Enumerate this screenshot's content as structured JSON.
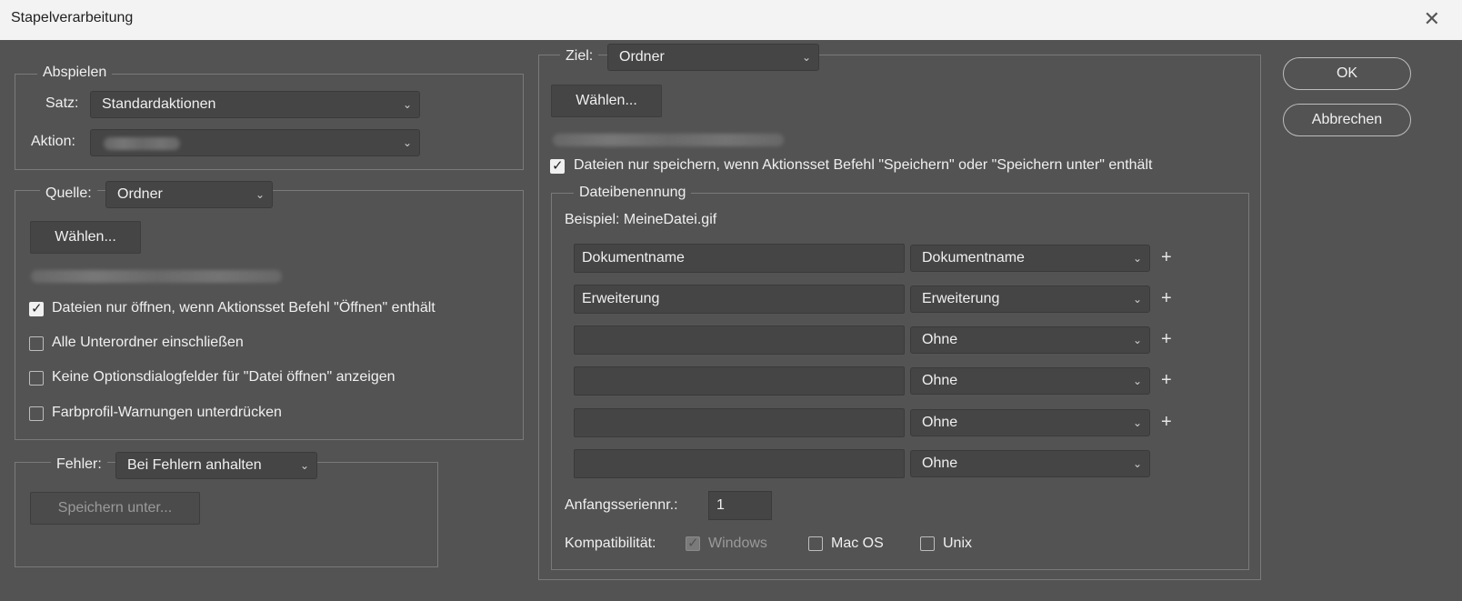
{
  "window": {
    "title": "Stapelverarbeitung",
    "close_glyph": "✕"
  },
  "buttons": {
    "ok": "OK",
    "cancel": "Abbrechen"
  },
  "play": {
    "legend": "Abspielen",
    "set_label": "Satz:",
    "set_value": "Standardaktionen",
    "action_label": "Aktion:"
  },
  "source": {
    "label": "Quelle:",
    "value": "Ordner",
    "choose_button": "Wählen...",
    "options": [
      {
        "label": "Dateien nur öffnen, wenn Aktionsset Befehl \"Öffnen\" enthält",
        "checked": true
      },
      {
        "label": "Alle Unterordner einschließen",
        "checked": false
      },
      {
        "label": "Keine Optionsdialogfelder für \"Datei öffnen\" anzeigen",
        "checked": false
      },
      {
        "label": "Farbprofil-Warnungen unterdrücken",
        "checked": false
      }
    ]
  },
  "errors": {
    "label": "Fehler:",
    "value": "Bei Fehlern anhalten",
    "save_as_button": "Speichern unter..."
  },
  "target": {
    "label": "Ziel:",
    "value": "Ordner",
    "choose_button": "Wählen...",
    "save_only_label": "Dateien nur speichern, wenn Aktionsset Befehl \"Speichern\" oder \"Speichern unter\" enthält",
    "save_only_checked": true
  },
  "naming": {
    "legend": "Dateibenennung",
    "example": "Beispiel: MeineDatei.gif",
    "rows": [
      {
        "text": "Dokumentname",
        "select": "Dokumentname",
        "plus": "+"
      },
      {
        "text": "Erweiterung",
        "select": "Erweiterung",
        "plus": "+"
      },
      {
        "text": "",
        "select": "Ohne",
        "plus": "+"
      },
      {
        "text": "",
        "select": "Ohne",
        "plus": "+"
      },
      {
        "text": "",
        "select": "Ohne",
        "plus": "+"
      },
      {
        "text": "",
        "select": "Ohne",
        "plus": ""
      }
    ],
    "serial_label": "Anfangsseriennr.:",
    "serial_value": "1",
    "compat_label": "Kompatibilität:",
    "compat": [
      {
        "label": "Windows",
        "checked": true,
        "disabled": true
      },
      {
        "label": "Mac OS",
        "checked": false,
        "disabled": false
      },
      {
        "label": "Unix",
        "checked": false,
        "disabled": false
      }
    ]
  },
  "icons": {
    "chevron": "chevron-down-icon",
    "check": "check-icon",
    "close": "close-icon",
    "plus": "plus-icon"
  }
}
